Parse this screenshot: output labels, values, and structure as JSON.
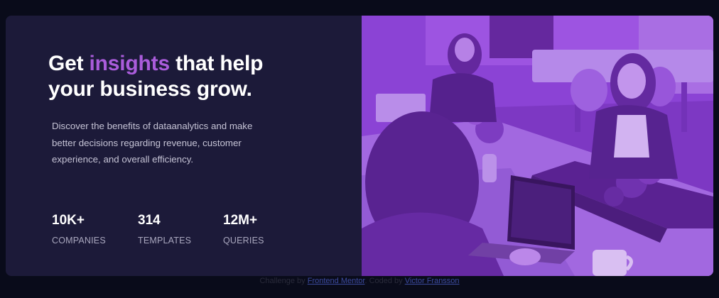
{
  "hero": {
    "headline_before": "Get ",
    "headline_accent": "insights",
    "headline_after": " that help your business grow.",
    "description": "Discover the benefits of dataanalytics and make better decisions regarding revenue, customer experience, and overall efficiency."
  },
  "stats": [
    {
      "value": "10K+",
      "label": "COMPANIES"
    },
    {
      "value": "314",
      "label": "TEMPLATES"
    },
    {
      "value": "12M+",
      "label": "QUERIES"
    }
  ],
  "attribution": {
    "prefix": "Challenge by",
    "link1": "Frontend Mentor",
    "middle": ". Coded by",
    "link2": "Victor Fransson"
  },
  "colors": {
    "page_bg": "#090b1a",
    "card_bg": "#1c1a39",
    "accent": "#aa5cdb",
    "photo_overlay": "#8a3fd0"
  }
}
